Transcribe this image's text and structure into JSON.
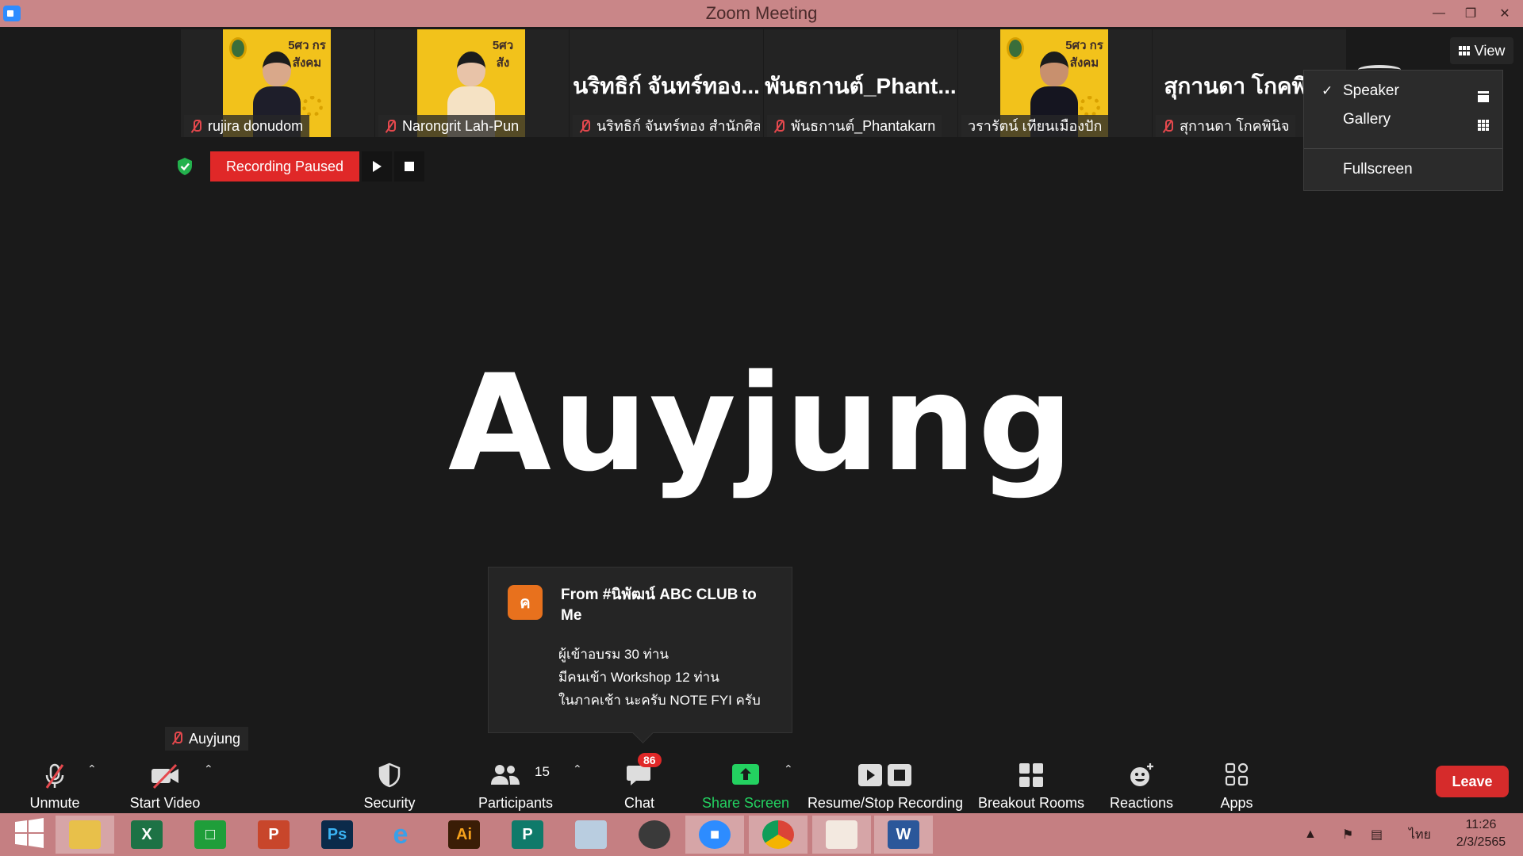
{
  "window": {
    "title": "Zoom Meeting"
  },
  "thumbnails": [
    {
      "name": "rujira donudom",
      "type": "photo",
      "logo": "5ศว กร สังคม"
    },
    {
      "name": "Narongrit Lah-Pun",
      "type": "photo",
      "logo": "5ศว สัง"
    },
    {
      "name": "นริทธิก์ จันทร์ทอง สำนักศิล...",
      "type": "text",
      "display": "นริทธิก์ จันทร์ทอง..."
    },
    {
      "name": "พันธกานต์_Phantakarn",
      "type": "text",
      "display": "พันธกานต์_Phant..."
    },
    {
      "name": "วรารัตน์ เทียนเมืองปัก",
      "type": "photo",
      "logo": "5ศว กร สังคม"
    },
    {
      "name": "สุกานดา โกคพินิจ",
      "type": "text",
      "display": "สุกานดา โกคพินิจ"
    }
  ],
  "recording": {
    "status": "Recording Paused"
  },
  "view_button": {
    "label": "View"
  },
  "view_menu": {
    "speaker": "Speaker",
    "gallery": "Gallery",
    "fullscreen": "Fullscreen",
    "selected": "Speaker"
  },
  "active_speaker": {
    "name": "Auyjung"
  },
  "chat_popup": {
    "avatar_letter": "ค",
    "from": "From #นิพัฒน์ ABC CLUB to Me",
    "lines": [
      "ผู้เข้าอบรม 30 ท่าน",
      "มีคนเข้า Workshop 12 ท่าน",
      "ในภาคเช้า นะครับ NOTE FYI ครับ"
    ]
  },
  "self_tag": {
    "name": "Auyjung"
  },
  "toolbar": {
    "unmute": "Unmute",
    "start_video": "Start Video",
    "security": "Security",
    "participants": "Participants",
    "participants_count": "15",
    "chat": "Chat",
    "chat_badge": "86",
    "share_screen": "Share Screen",
    "recording": "Resume/Stop Recording",
    "breakout": "Breakout Rooms",
    "reactions": "Reactions",
    "apps": "Apps",
    "leave": "Leave"
  },
  "taskbar": {
    "language": "ไทย",
    "time": "11:26",
    "date": "2/3/2565"
  },
  "colors": {
    "title_bar": "#c98688",
    "accent_red": "#e02828",
    "share_green": "#23d160",
    "zoom_blue": "#2d8cff"
  }
}
